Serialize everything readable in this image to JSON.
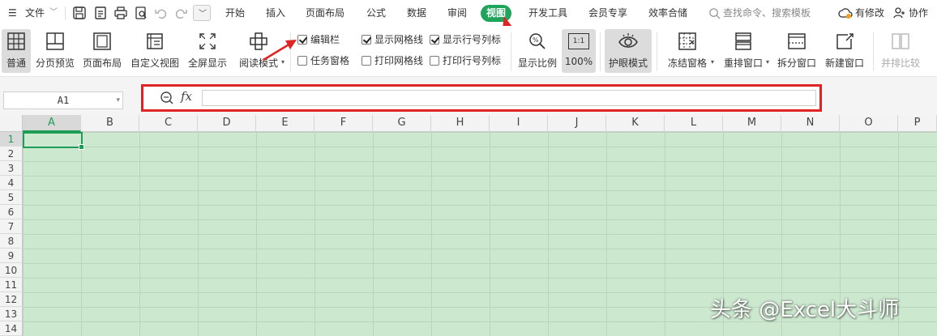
{
  "menu": {
    "file_label": "文件",
    "tabs": [
      "开始",
      "插入",
      "页面布局",
      "公式",
      "数据",
      "审阅",
      "视图",
      "开发工具",
      "会员专享",
      "效率合储"
    ],
    "active_tab": "视图",
    "search_placeholder": "查找命令、搜索模板",
    "modified_label": "有修改",
    "collab_label": "协作"
  },
  "ribbon": {
    "normal": "普通",
    "page_break_preview": "分页预览",
    "page_layout": "页面布局",
    "custom_view": "自定义视图",
    "fullscreen": "全屏显示",
    "reading_mode": "阅读模式",
    "checkboxes": {
      "formula_bar": {
        "label": "编辑栏",
        "checked": true
      },
      "task_pane": {
        "label": "任务窗格",
        "checked": false
      },
      "show_gridlines": {
        "label": "显示网格线",
        "checked": true
      },
      "print_gridlines": {
        "label": "打印网格线",
        "checked": false
      },
      "show_headings": {
        "label": "显示行号列标",
        "checked": true
      },
      "print_headings": {
        "label": "打印行号列标",
        "checked": false
      }
    },
    "zoom": "显示比例",
    "zoom_100": "100%",
    "zoom_ratio_icon_text": "1:1",
    "eye_protection": "护眼模式",
    "freeze_panes": "冻结窗格",
    "arrange_windows": "重排窗口",
    "split_window": "拆分窗口",
    "new_window": "新建窗口",
    "side_by_side": "并排比较"
  },
  "formula_bar": {
    "name_box": "A1",
    "fx_label": "fx",
    "value": ""
  },
  "sheet": {
    "columns": [
      "A",
      "B",
      "C",
      "D",
      "E",
      "F",
      "G",
      "H",
      "I",
      "J",
      "K",
      "L",
      "M",
      "N",
      "O",
      "P"
    ],
    "rows": [
      "1",
      "2",
      "3",
      "4",
      "5",
      "6",
      "7",
      "8",
      "9",
      "10",
      "11",
      "12",
      "13",
      "14"
    ],
    "active_cell": "A1"
  },
  "watermark": "头条 @Excel大斗师",
  "colors": {
    "accent": "#1fa55b",
    "annotation_red": "#e02424",
    "eye_protect_bg": "#cce8cf"
  }
}
